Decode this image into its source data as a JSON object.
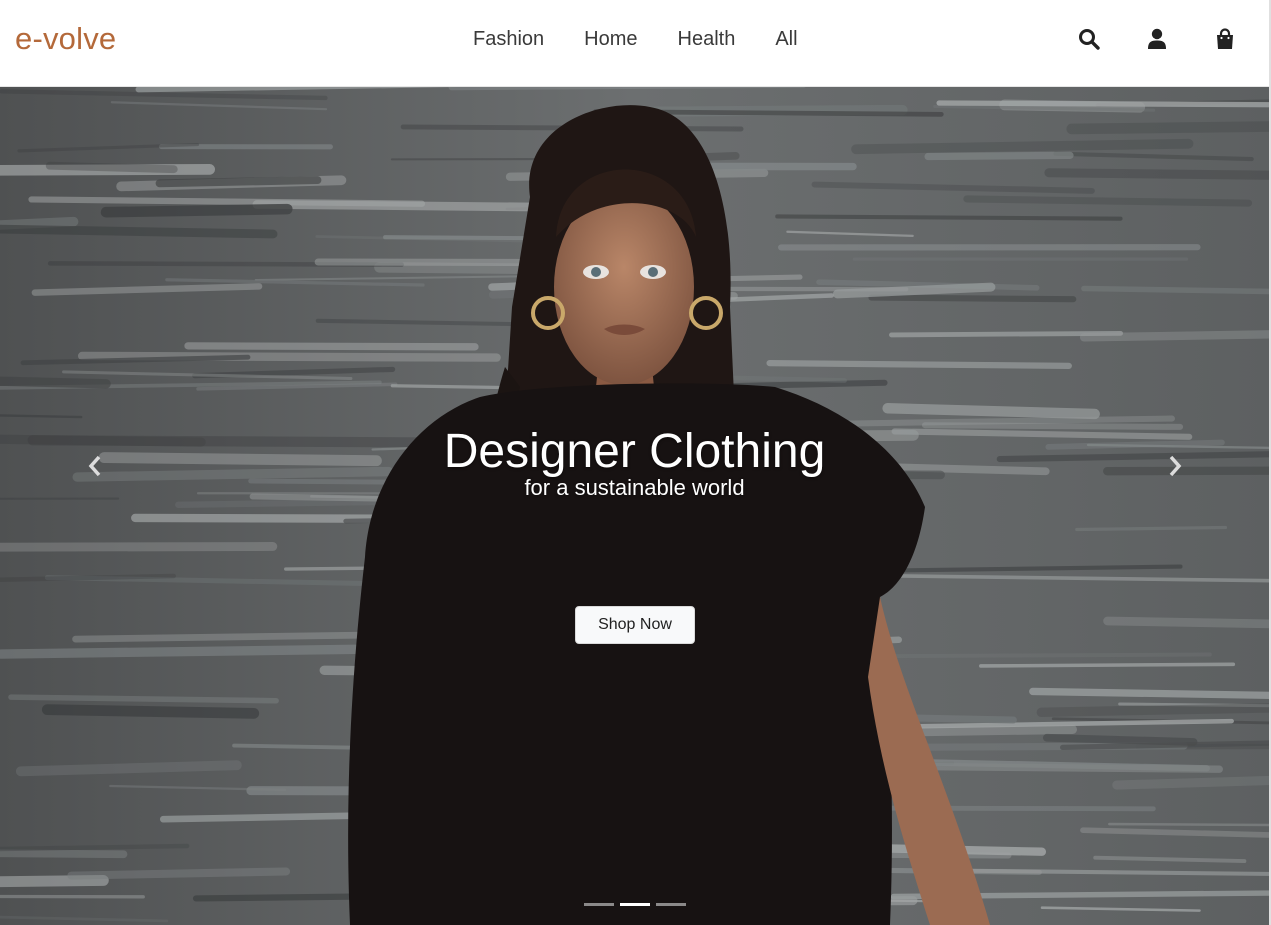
{
  "brand": {
    "name": "e-volve",
    "color": "#b4693a"
  },
  "nav": {
    "items": [
      {
        "label": "Fashion"
      },
      {
        "label": "Home"
      },
      {
        "label": "Health"
      },
      {
        "label": "All"
      }
    ]
  },
  "header_icons": [
    "search-icon",
    "user-icon",
    "shopping-bag-icon"
  ],
  "hero": {
    "title": "Designer Clothing",
    "subtitle": "for a sustainable world",
    "cta_label": "Shop Now",
    "slide_count": 3,
    "active_slide": 2
  }
}
